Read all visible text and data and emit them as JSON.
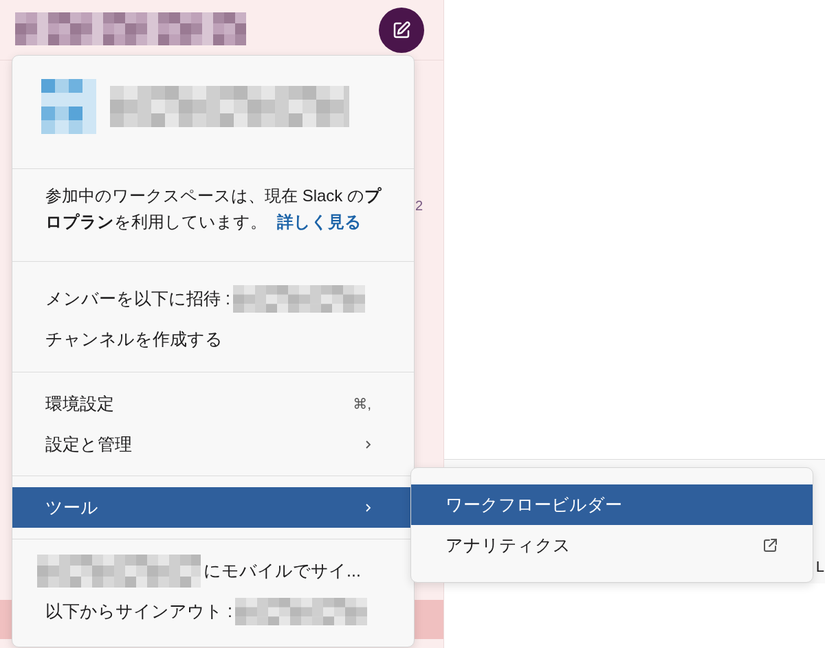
{
  "sidebar": {
    "badge": "2"
  },
  "main": {
    "edge_text": "L"
  },
  "menu": {
    "plan_notice": {
      "text": "参加中のワークスペースは、現在 Slack の**プロプラン**を利用しています。",
      "link": "詳しく見る"
    },
    "sections": [
      [
        {
          "label": "メンバーを以下に招待 :",
          "kind": "plain",
          "masked_after": true,
          "selected": false
        },
        {
          "label": "チャンネルを作成する",
          "kind": "plain",
          "selected": false
        }
      ],
      [
        {
          "label": "環境設定",
          "kind": "shortcut",
          "shortcut": "⌘,",
          "selected": false
        },
        {
          "label": "設定と管理",
          "kind": "submenu",
          "selected": false
        }
      ],
      [
        {
          "label": "ツール",
          "kind": "submenu",
          "selected": true
        }
      ],
      [
        {
          "label": "にモバイルでサイ...",
          "kind": "plain",
          "masked_before": true,
          "selected": false
        },
        {
          "label": "以下からサインアウト :",
          "kind": "plain",
          "masked_after": true,
          "selected": false
        }
      ]
    ]
  },
  "submenu": {
    "items": [
      {
        "label": "ワークフロービルダー",
        "kind": "plain",
        "selected": true
      },
      {
        "label": "アナリティクス",
        "kind": "external",
        "selected": false
      }
    ]
  }
}
